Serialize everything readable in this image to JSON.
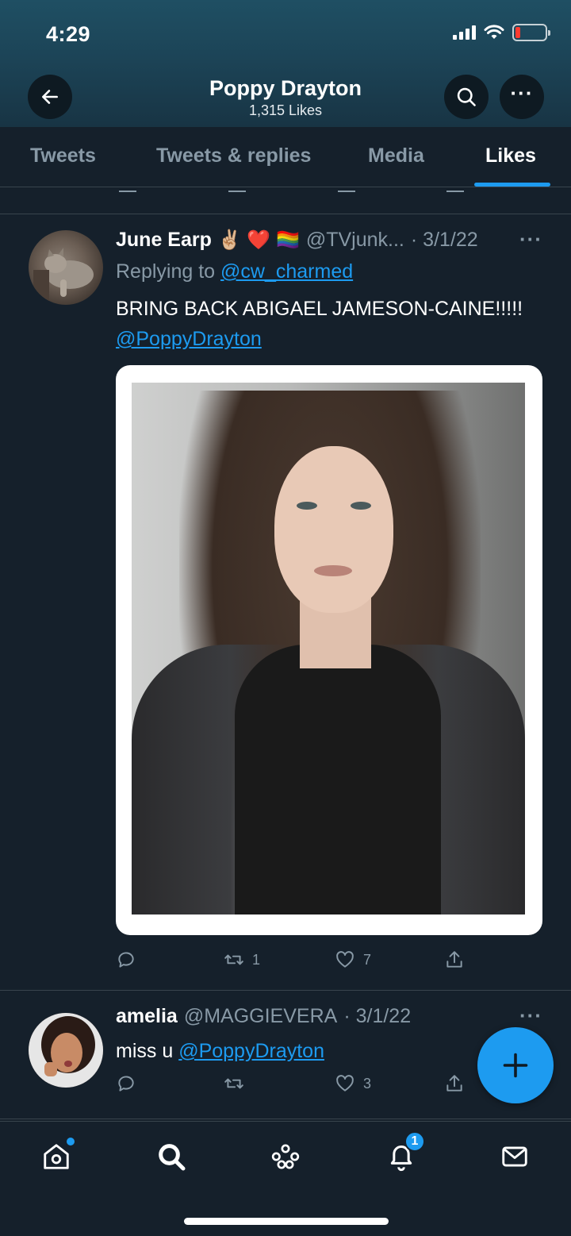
{
  "status_bar": {
    "time": "4:29"
  },
  "header": {
    "name": "Poppy Drayton",
    "likes_count": "1,315 Likes"
  },
  "tabs": [
    {
      "label": "Tweets",
      "active": false
    },
    {
      "label": "Tweets & replies",
      "active": false
    },
    {
      "label": "Media",
      "active": false
    },
    {
      "label": "Likes",
      "active": true
    }
  ],
  "tweets": [
    {
      "author": "June Earp",
      "emojis": "✌🏼 ❤️ 🏳️‍🌈",
      "handle": "@TVjunk...",
      "date": "· 3/1/22",
      "replying_prefix": "Replying to ",
      "replying_to": "@cw_charmed",
      "text": "BRING BACK ABIGAEL JAMESON-CAINE!!!!! ",
      "mention": "@PoppyDrayton",
      "retweets": "1",
      "likes": "7",
      "has_photo": true
    },
    {
      "author": "amelia",
      "handle": "@MAGGIEVERA",
      "date": "· 3/1/22",
      "text": "miss u ",
      "mention": "@PoppyDrayton",
      "retweets": "",
      "likes": "3",
      "has_photo": false
    }
  ],
  "bottom_nav": {
    "items": [
      "home-icon",
      "search-icon",
      "spaces-icon",
      "notifications-icon",
      "messages-icon"
    ],
    "notification_count": "1"
  },
  "colors": {
    "background": "#15202b",
    "accent": "#1d9bf0",
    "secondary_text": "#8899a6",
    "divider": "#38444d"
  }
}
